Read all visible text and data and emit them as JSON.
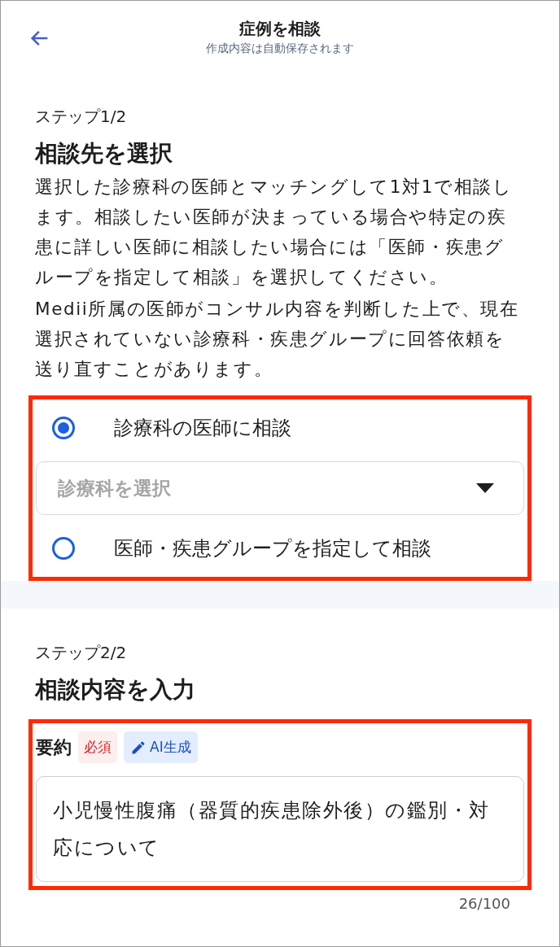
{
  "header": {
    "title": "症例を相談",
    "subtitle": "作成内容は自動保存されます"
  },
  "step1": {
    "step_label": "ステップ1/2",
    "heading": "相談先を選択",
    "description": [
      "選択した診療科の医師とマッチングして1対1で相談します。相談したい医師が決まっている場合や特定の疾患に詳しい医師に相談したい場合には「医師・疾患グループを指定して相談」を選択してください。",
      "Medii所属の医師がコンサル内容を判断した上で、現在選択されていない診療科・疾患グループに回答依頼を送り直すことがあります。"
    ],
    "options": [
      {
        "kind": "radio",
        "label": "診療科の医師に相談",
        "selected": true
      },
      {
        "kind": "select",
        "placeholder": "診療科を選択"
      },
      {
        "kind": "radio",
        "label": "医師・疾患グループを指定して相談",
        "selected": false
      }
    ]
  },
  "step2": {
    "step_label": "ステップ2/2",
    "heading": "相談内容を入力",
    "summary": {
      "label": "要約",
      "required_badge": "必須",
      "ai_button": "AI生成",
      "value": "小児慢性腹痛（器質的疾患除外後）の鑑別・対応について",
      "counter": "26/100"
    }
  }
}
